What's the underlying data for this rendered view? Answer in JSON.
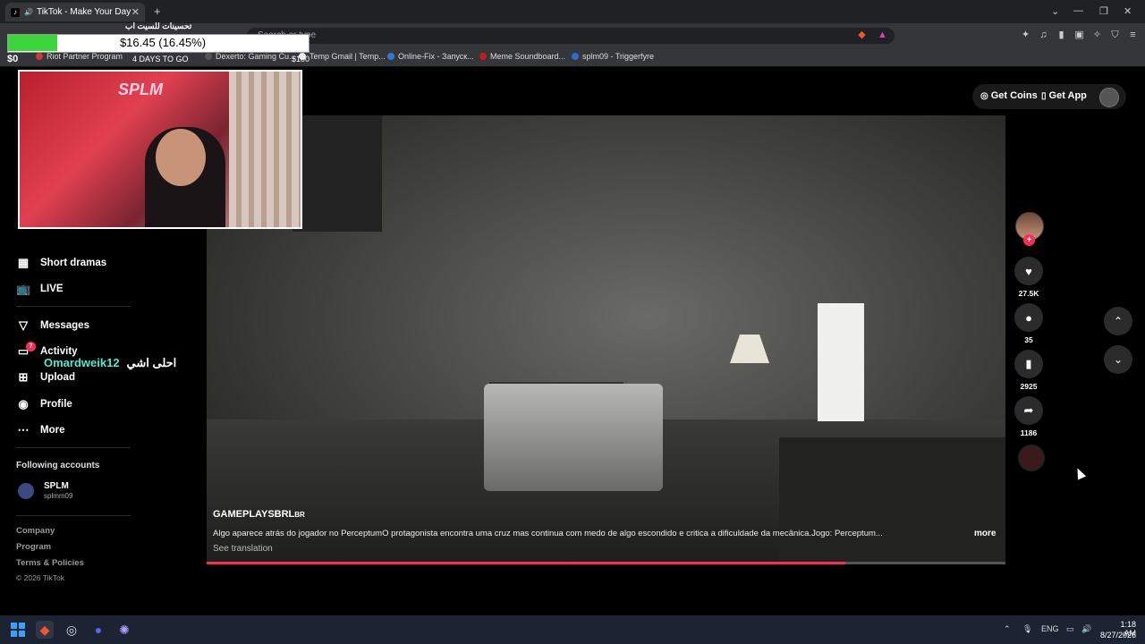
{
  "browser": {
    "tab_title": "TikTok - Make Your Day",
    "tab_close": "✕",
    "new_tab": "+",
    "address_hint": "Search or type",
    "bookmarks": [
      {
        "label": "Riot Partner Program",
        "color": "#d13639"
      },
      {
        "label": "Dexerto: Gaming Cu...",
        "color": "#555555"
      },
      {
        "label": "Temp Gmail | Temp...",
        "color": "#e8e8e8"
      },
      {
        "label": "Online-Fix - Запуск...",
        "color": "#2b7bd6"
      },
      {
        "label": "Meme Soundboard...",
        "color": "#c41b1b"
      },
      {
        "label": "splm09 - Triggerfyre",
        "color": "#2b6bd6"
      }
    ],
    "window_controls": [
      "⌄",
      "—",
      "❐",
      "✕"
    ]
  },
  "stream_overlay": {
    "title": "تحسينات للسيت اب",
    "amount": "$16.45 (16.45%)",
    "left_amount": "$0",
    "days": "4 DAYS TO GO",
    "goal": "$100",
    "fill_fraction": 0.1645,
    "accent": "#3bd63b"
  },
  "tiktok": {
    "header": {
      "get_coins": "Get Coins",
      "get_app": "Get App"
    },
    "sidebar": {
      "items": [
        {
          "label": "Short dramas",
          "icon": "film-icon"
        },
        {
          "label": "LIVE",
          "icon": "live-tv-icon"
        },
        {
          "label": "Messages",
          "icon": "paper-plane-icon"
        },
        {
          "label": "Activity",
          "icon": "activity-icon",
          "badge": "7"
        },
        {
          "label": "Upload",
          "icon": "upload-icon"
        },
        {
          "label": "Profile",
          "icon": "avatar-icon"
        },
        {
          "label": "More",
          "icon": "more-dots-icon"
        }
      ],
      "following_title": "Following accounts",
      "following": [
        {
          "name": "SPLM",
          "handle": "splmm09"
        }
      ],
      "footer": [
        "Company",
        "Program",
        "Terms & Policies"
      ],
      "copyright": "© 2026 TikTok"
    },
    "chat_overlay": {
      "username": "Omardweik12",
      "message": "احلى اشي"
    },
    "video": {
      "author": "GAMEPLAYSBRL",
      "author_badge": "BR",
      "description": "Algo aparece atrás do jogador no PerceptumO protagonista encontra uma cruz mas continua com medo de algo escondido e critica a dificuldade da mecânica.Jogo: Perceptum...",
      "see_translation": "See translation",
      "more": "more",
      "progress": 0.8
    },
    "actions": [
      {
        "name": "like",
        "icon": "heart-icon",
        "count": "27.5K"
      },
      {
        "name": "comment",
        "icon": "comment-icon",
        "count": "35"
      },
      {
        "name": "save",
        "icon": "bookmark-icon",
        "count": "2925"
      },
      {
        "name": "share",
        "icon": "share-icon",
        "count": "1186"
      }
    ],
    "accent": "#fe2c55"
  },
  "taskbar": {
    "lang": "ENG",
    "time": "1:18 AM",
    "date": "8/27/2026"
  }
}
